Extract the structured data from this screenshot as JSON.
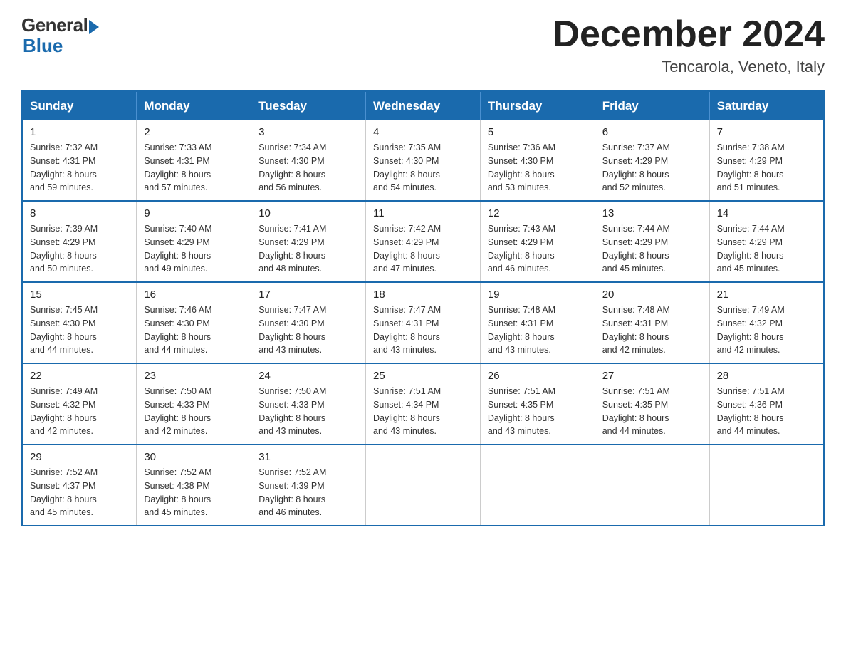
{
  "header": {
    "logo_general": "General",
    "logo_blue": "Blue",
    "month_title": "December 2024",
    "location": "Tencarola, Veneto, Italy"
  },
  "days_of_week": [
    "Sunday",
    "Monday",
    "Tuesday",
    "Wednesday",
    "Thursday",
    "Friday",
    "Saturday"
  ],
  "weeks": [
    [
      {
        "day": "1",
        "sunrise": "7:32 AM",
        "sunset": "4:31 PM",
        "daylight": "8 hours and 59 minutes."
      },
      {
        "day": "2",
        "sunrise": "7:33 AM",
        "sunset": "4:31 PM",
        "daylight": "8 hours and 57 minutes."
      },
      {
        "day": "3",
        "sunrise": "7:34 AM",
        "sunset": "4:30 PM",
        "daylight": "8 hours and 56 minutes."
      },
      {
        "day": "4",
        "sunrise": "7:35 AM",
        "sunset": "4:30 PM",
        "daylight": "8 hours and 54 minutes."
      },
      {
        "day": "5",
        "sunrise": "7:36 AM",
        "sunset": "4:30 PM",
        "daylight": "8 hours and 53 minutes."
      },
      {
        "day": "6",
        "sunrise": "7:37 AM",
        "sunset": "4:29 PM",
        "daylight": "8 hours and 52 minutes."
      },
      {
        "day": "7",
        "sunrise": "7:38 AM",
        "sunset": "4:29 PM",
        "daylight": "8 hours and 51 minutes."
      }
    ],
    [
      {
        "day": "8",
        "sunrise": "7:39 AM",
        "sunset": "4:29 PM",
        "daylight": "8 hours and 50 minutes."
      },
      {
        "day": "9",
        "sunrise": "7:40 AM",
        "sunset": "4:29 PM",
        "daylight": "8 hours and 49 minutes."
      },
      {
        "day": "10",
        "sunrise": "7:41 AM",
        "sunset": "4:29 PM",
        "daylight": "8 hours and 48 minutes."
      },
      {
        "day": "11",
        "sunrise": "7:42 AM",
        "sunset": "4:29 PM",
        "daylight": "8 hours and 47 minutes."
      },
      {
        "day": "12",
        "sunrise": "7:43 AM",
        "sunset": "4:29 PM",
        "daylight": "8 hours and 46 minutes."
      },
      {
        "day": "13",
        "sunrise": "7:44 AM",
        "sunset": "4:29 PM",
        "daylight": "8 hours and 45 minutes."
      },
      {
        "day": "14",
        "sunrise": "7:44 AM",
        "sunset": "4:29 PM",
        "daylight": "8 hours and 45 minutes."
      }
    ],
    [
      {
        "day": "15",
        "sunrise": "7:45 AM",
        "sunset": "4:30 PM",
        "daylight": "8 hours and 44 minutes."
      },
      {
        "day": "16",
        "sunrise": "7:46 AM",
        "sunset": "4:30 PM",
        "daylight": "8 hours and 44 minutes."
      },
      {
        "day": "17",
        "sunrise": "7:47 AM",
        "sunset": "4:30 PM",
        "daylight": "8 hours and 43 minutes."
      },
      {
        "day": "18",
        "sunrise": "7:47 AM",
        "sunset": "4:31 PM",
        "daylight": "8 hours and 43 minutes."
      },
      {
        "day": "19",
        "sunrise": "7:48 AM",
        "sunset": "4:31 PM",
        "daylight": "8 hours and 43 minutes."
      },
      {
        "day": "20",
        "sunrise": "7:48 AM",
        "sunset": "4:31 PM",
        "daylight": "8 hours and 42 minutes."
      },
      {
        "day": "21",
        "sunrise": "7:49 AM",
        "sunset": "4:32 PM",
        "daylight": "8 hours and 42 minutes."
      }
    ],
    [
      {
        "day": "22",
        "sunrise": "7:49 AM",
        "sunset": "4:32 PM",
        "daylight": "8 hours and 42 minutes."
      },
      {
        "day": "23",
        "sunrise": "7:50 AM",
        "sunset": "4:33 PM",
        "daylight": "8 hours and 42 minutes."
      },
      {
        "day": "24",
        "sunrise": "7:50 AM",
        "sunset": "4:33 PM",
        "daylight": "8 hours and 43 minutes."
      },
      {
        "day": "25",
        "sunrise": "7:51 AM",
        "sunset": "4:34 PM",
        "daylight": "8 hours and 43 minutes."
      },
      {
        "day": "26",
        "sunrise": "7:51 AM",
        "sunset": "4:35 PM",
        "daylight": "8 hours and 43 minutes."
      },
      {
        "day": "27",
        "sunrise": "7:51 AM",
        "sunset": "4:35 PM",
        "daylight": "8 hours and 44 minutes."
      },
      {
        "day": "28",
        "sunrise": "7:51 AM",
        "sunset": "4:36 PM",
        "daylight": "8 hours and 44 minutes."
      }
    ],
    [
      {
        "day": "29",
        "sunrise": "7:52 AM",
        "sunset": "4:37 PM",
        "daylight": "8 hours and 45 minutes."
      },
      {
        "day": "30",
        "sunrise": "7:52 AM",
        "sunset": "4:38 PM",
        "daylight": "8 hours and 45 minutes."
      },
      {
        "day": "31",
        "sunrise": "7:52 AM",
        "sunset": "4:39 PM",
        "daylight": "8 hours and 46 minutes."
      },
      null,
      null,
      null,
      null
    ]
  ],
  "labels": {
    "sunrise_prefix": "Sunrise: ",
    "sunset_prefix": "Sunset: ",
    "daylight_prefix": "Daylight: "
  }
}
